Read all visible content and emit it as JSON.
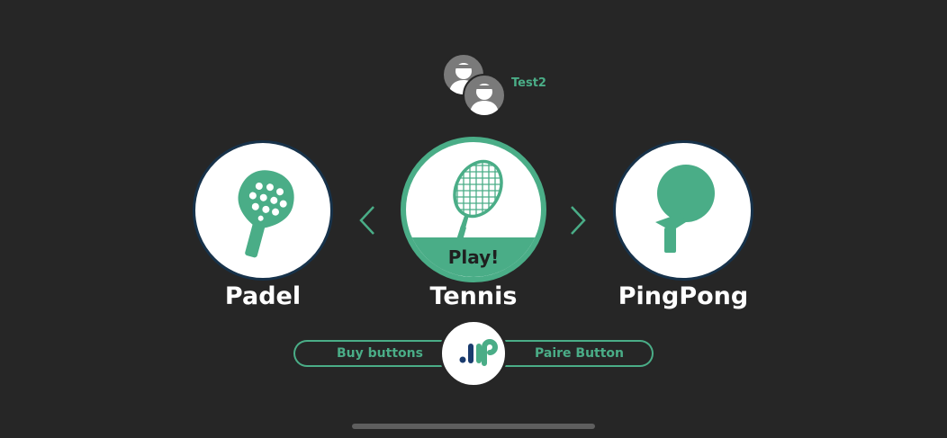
{
  "users": {
    "name": "Test2",
    "avatar_icon": "user-avatar-icon"
  },
  "sports": {
    "padel": {
      "label": "Padel",
      "icon": "padel-racket-icon"
    },
    "tennis": {
      "label": "Tennis",
      "icon": "tennis-racket-icon",
      "play_label": "Play!"
    },
    "pingpong": {
      "label": "PingPong",
      "icon": "pingpong-paddle-icon"
    }
  },
  "navigation": {
    "previous_icon": "chevron-left-icon",
    "next_icon": "chevron-right-icon"
  },
  "bottom_bar": {
    "buy_label": "Buy buttons",
    "paire_label": "Paire Button",
    "logo_icon": "app-logo-icon"
  },
  "colors": {
    "background": "#262626",
    "accent": "#4aad87",
    "ring_dark": "#17324a",
    "logo_blue": "#1a3b6e",
    "avatar_gray": "#7a7a7a"
  }
}
